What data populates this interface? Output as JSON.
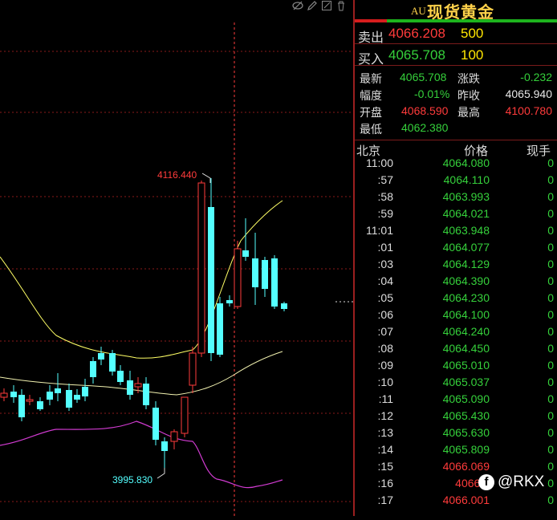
{
  "header": {
    "code": "AU",
    "name": "现货黄金"
  },
  "orderbook": {
    "sell_label": "卖出",
    "sell_price": "4066.208",
    "sell_volume": "500",
    "buy_label": "买入",
    "buy_price": "4065.708",
    "buy_volume": "100"
  },
  "quote": {
    "last_label": "最新",
    "last": "4065.708",
    "change_label": "涨跌",
    "change": "-0.232",
    "pct_label": "幅度",
    "pct": "-0.01%",
    "prev_close_label": "昨收",
    "prev_close": "4065.940",
    "open_label": "开盘",
    "open": "4068.590",
    "high_label": "最高",
    "high": "4100.780",
    "low_label": "最低",
    "low": "4062.380"
  },
  "ticks": {
    "col_time": "北京",
    "col_price": "价格",
    "col_vol": "现手",
    "rows": [
      {
        "t": "11:00",
        "p": "4064.080",
        "v": "0",
        "c": "green"
      },
      {
        "t": ":57",
        "p": "4064.110",
        "v": "0",
        "c": "green"
      },
      {
        "t": ":58",
        "p": "4063.993",
        "v": "0",
        "c": "green"
      },
      {
        "t": ":59",
        "p": "4064.021",
        "v": "0",
        "c": "green"
      },
      {
        "t": "11:01",
        "p": "4063.948",
        "v": "0",
        "c": "green"
      },
      {
        "t": ":01",
        "p": "4064.077",
        "v": "0",
        "c": "green"
      },
      {
        "t": ":03",
        "p": "4064.129",
        "v": "0",
        "c": "green"
      },
      {
        "t": ":04",
        "p": "4064.390",
        "v": "0",
        "c": "green"
      },
      {
        "t": ":05",
        "p": "4064.230",
        "v": "0",
        "c": "green"
      },
      {
        "t": ":06",
        "p": "4064.100",
        "v": "0",
        "c": "green"
      },
      {
        "t": ":07",
        "p": "4064.240",
        "v": "0",
        "c": "green"
      },
      {
        "t": ":08",
        "p": "4064.450",
        "v": "0",
        "c": "green"
      },
      {
        "t": ":09",
        "p": "4065.010",
        "v": "0",
        "c": "green"
      },
      {
        "t": ":10",
        "p": "4065.037",
        "v": "0",
        "c": "green"
      },
      {
        "t": ":11",
        "p": "4065.090",
        "v": "0",
        "c": "green"
      },
      {
        "t": ":12",
        "p": "4065.430",
        "v": "0",
        "c": "green"
      },
      {
        "t": ":13",
        "p": "4065.630",
        "v": "0",
        "c": "green"
      },
      {
        "t": ":14",
        "p": "4065.809",
        "v": "0",
        "c": "green"
      },
      {
        "t": ":15",
        "p": "4066.069",
        "v": "0",
        "c": "red"
      },
      {
        "t": ":16",
        "p": "4066.0",
        "v": "0",
        "c": "red"
      },
      {
        "t": ":17",
        "p": "4066.001",
        "v": "0",
        "c": "red"
      }
    ]
  },
  "chart": {
    "high_marker": "4116.440",
    "low_marker": "3995.830",
    "up_color": "#ff3b3b",
    "down_color": "#54ffff"
  },
  "watermark": {
    "icon": "facebook-icon",
    "text": "@RKX"
  },
  "colors": {
    "up": "#ff3b3b",
    "down": "#35d03b",
    "accent_red": "#d61d1d",
    "accent_green": "#1db31d",
    "title": "#ffd24a"
  }
}
